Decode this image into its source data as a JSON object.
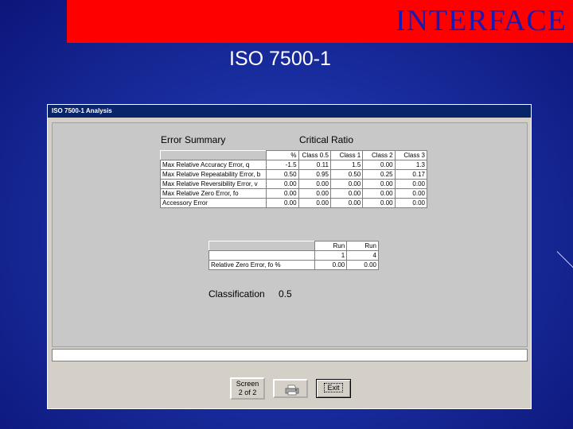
{
  "slide": {
    "banner_title": "INTERFACE",
    "subtitle": "ISO 7500-1"
  },
  "window": {
    "title": "ISO 7500-1 Analysis"
  },
  "error_summary": {
    "heading": "Error Summary",
    "critical_ratio_heading": "Critical Ratio",
    "columns": [
      "%",
      "Class 0.5",
      "Class 1",
      "Class 2",
      "Class 3"
    ],
    "rows": [
      {
        "label": "Max Relative Accuracy Error, q",
        "values": [
          "-1.5",
          "0.11",
          "1.5",
          "0.00",
          "1.3"
        ]
      },
      {
        "label": "Max Relative Repeatability Error, b",
        "values": [
          "0.50",
          "0.95",
          "0.50",
          "0.25",
          "0.17"
        ]
      },
      {
        "label": "Max Relative Reversibility Error, v",
        "values": [
          "0.00",
          "0.00",
          "0.00",
          "0.00",
          "0.00"
        ]
      },
      {
        "label": "Max Relative Zero Error, fo",
        "values": [
          "0.00",
          "0.00",
          "0.00",
          "0.00",
          "0.00"
        ]
      },
      {
        "label": "Accessory Error",
        "values": [
          "0.00",
          "0.00",
          "0.00",
          "0.00",
          "0.00"
        ]
      }
    ]
  },
  "zero_error": {
    "col_headers_top": [
      "Run",
      "Run"
    ],
    "col_headers_bottom": [
      "1",
      "4"
    ],
    "row": {
      "label": "Relative Zero Error, fo %",
      "values": [
        "0.00",
        "0.00"
      ]
    }
  },
  "classification": {
    "label": "Classification",
    "value": "0.5"
  },
  "buttons": {
    "screen_line1": "Screen",
    "screen_line2": "2 of 2",
    "exit": "Exit"
  }
}
